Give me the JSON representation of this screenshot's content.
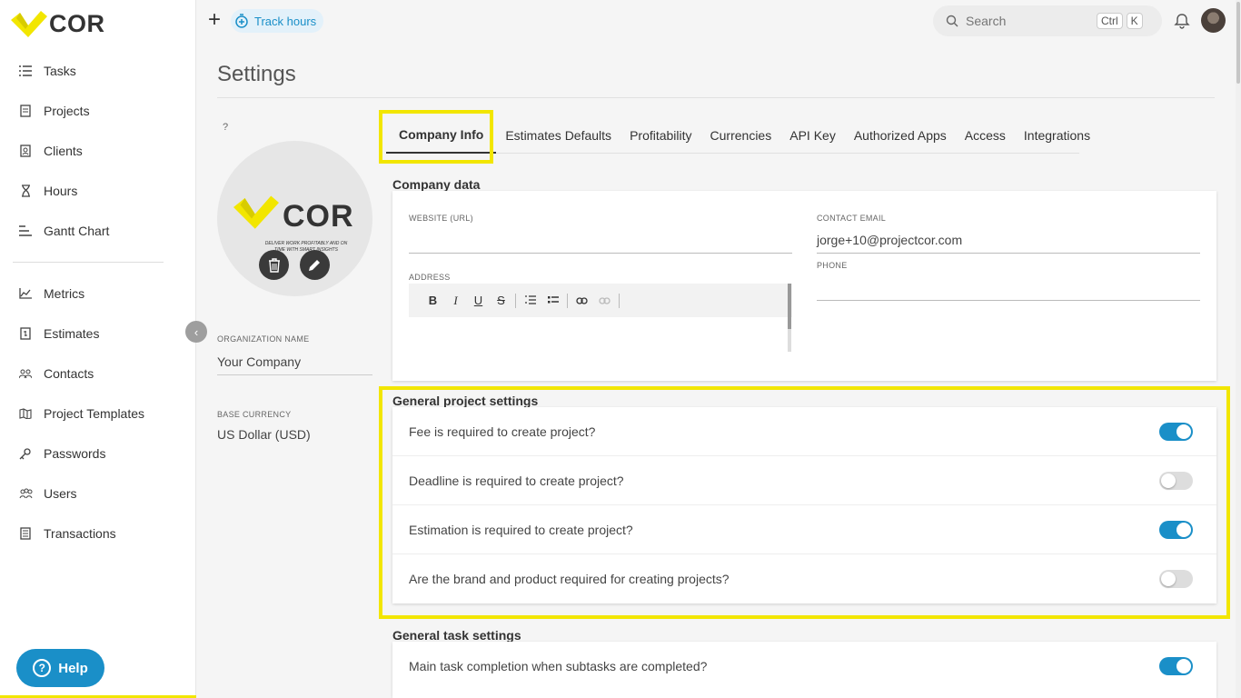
{
  "brand": {
    "name": "COR",
    "accent": "#f2e600",
    "primary": "#1a8fc8"
  },
  "sidebar": {
    "items": [
      {
        "label": "Tasks",
        "icon": "tasks-icon"
      },
      {
        "label": "Projects",
        "icon": "projects-icon"
      },
      {
        "label": "Clients",
        "icon": "clients-icon"
      },
      {
        "label": "Hours",
        "icon": "hourglass-icon"
      },
      {
        "label": "Gantt Chart",
        "icon": "gantt-icon"
      }
    ],
    "items2": [
      {
        "label": "Metrics",
        "icon": "metrics-icon"
      },
      {
        "label": "Estimates",
        "icon": "estimates-icon"
      },
      {
        "label": "Contacts",
        "icon": "contacts-icon"
      },
      {
        "label": "Project Templates",
        "icon": "map-icon"
      },
      {
        "label": "Passwords",
        "icon": "key-icon"
      },
      {
        "label": "Users",
        "icon": "users-icon"
      },
      {
        "label": "Transactions",
        "icon": "transactions-icon"
      }
    ],
    "help_label": "Help"
  },
  "topbar": {
    "track_hours": "Track hours",
    "search_placeholder": "Search",
    "shortcut_ctrl": "Ctrl",
    "shortcut_k": "K"
  },
  "page": {
    "title": "Settings"
  },
  "profile": {
    "qmark": "?",
    "logo_text": "COR",
    "logo_tagline": "DELIVER WORK PROFITABLY AND ON TIME WITH SMART INSIGHTS",
    "org_label": "ORGANIZATION NAME",
    "org_value": "Your Company",
    "currency_label": "BASE CURRENCY",
    "currency_value": "US Dollar (USD)"
  },
  "tabs": [
    "Company Info",
    "Estimates Defaults",
    "Profitability",
    "Currencies",
    "API Key",
    "Authorized Apps",
    "Access",
    "Integrations"
  ],
  "company": {
    "section_title": "Company data",
    "website_label": "WEBSITE (URL)",
    "website_value": "",
    "email_label": "CONTACT EMAIL",
    "email_value": "jorge+10@projectcor.com",
    "address_label": "ADDRESS",
    "phone_label": "PHONE",
    "phone_value": ""
  },
  "general_project": {
    "section_title": "General project settings",
    "rows": [
      {
        "label": "Fee is required to create project?",
        "on": true
      },
      {
        "label": "Deadline is required to create project?",
        "on": false
      },
      {
        "label": "Estimation is required to create project?",
        "on": true
      },
      {
        "label": "Are the brand and product required for creating projects?",
        "on": false
      }
    ]
  },
  "general_task": {
    "section_title": "General task settings",
    "rows": [
      {
        "label": "Main task completion when subtasks are completed?",
        "on": true
      }
    ]
  }
}
